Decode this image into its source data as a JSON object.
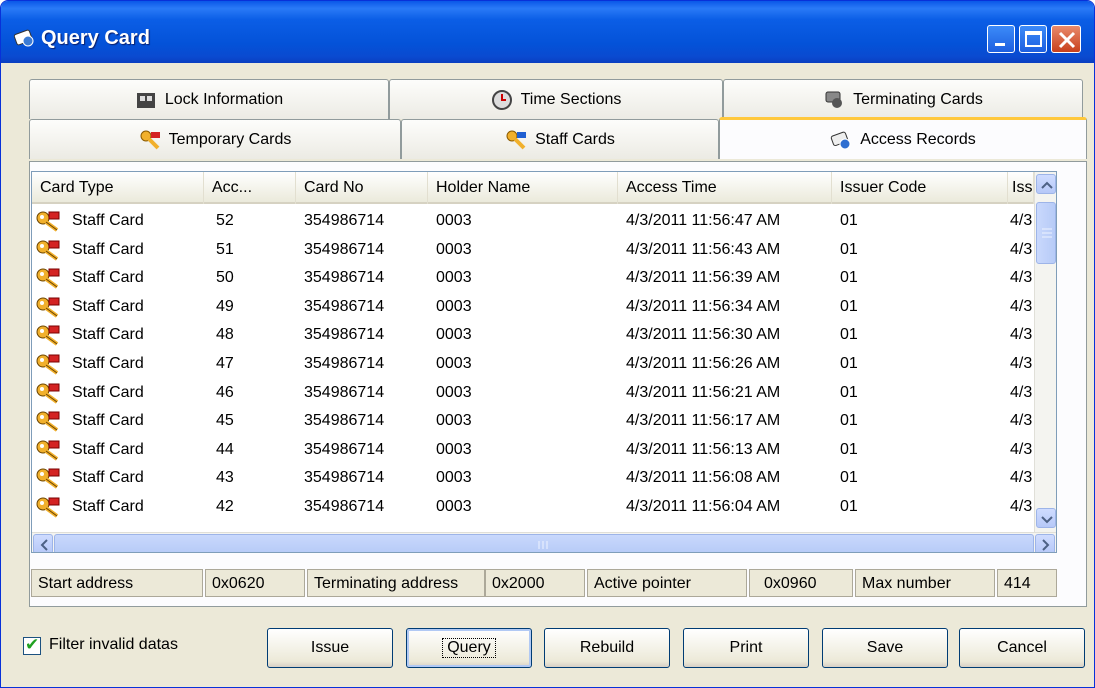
{
  "window": {
    "title": "Query Card"
  },
  "tabs_row1": [
    {
      "label": "Lock Information",
      "icon": "lock-info-icon"
    },
    {
      "label": "Time Sections",
      "icon": "time-sections-icon"
    },
    {
      "label": "Terminating Cards",
      "icon": "terminating-cards-icon"
    }
  ],
  "tabs_row2": [
    {
      "label": "Temporary Cards",
      "icon": "temporary-card-icon"
    },
    {
      "label": "Staff Cards",
      "icon": "staff-card-icon"
    },
    {
      "label": "Access Records",
      "icon": "access-records-icon",
      "active": true
    }
  ],
  "table": {
    "columns": [
      "Card Type",
      "Acc...",
      "Card No",
      "Holder Name",
      "Access Time",
      "Issuer Code",
      "Iss"
    ],
    "rows": [
      [
        "Staff Card",
        "52",
        "354986714",
        "0003",
        "4/3/2011 11:56:47 AM",
        "01",
        "4/3"
      ],
      [
        "Staff Card",
        "51",
        "354986714",
        "0003",
        "4/3/2011 11:56:43 AM",
        "01",
        "4/3"
      ],
      [
        "Staff Card",
        "50",
        "354986714",
        "0003",
        "4/3/2011 11:56:39 AM",
        "01",
        "4/3"
      ],
      [
        "Staff Card",
        "49",
        "354986714",
        "0003",
        "4/3/2011 11:56:34 AM",
        "01",
        "4/3"
      ],
      [
        "Staff Card",
        "48",
        "354986714",
        "0003",
        "4/3/2011 11:56:30 AM",
        "01",
        "4/3"
      ],
      [
        "Staff Card",
        "47",
        "354986714",
        "0003",
        "4/3/2011 11:56:26 AM",
        "01",
        "4/3"
      ],
      [
        "Staff Card",
        "46",
        "354986714",
        "0003",
        "4/3/2011 11:56:21 AM",
        "01",
        "4/3"
      ],
      [
        "Staff Card",
        "45",
        "354986714",
        "0003",
        "4/3/2011 11:56:17 AM",
        "01",
        "4/3"
      ],
      [
        "Staff Card",
        "44",
        "354986714",
        "0003",
        "4/3/2011 11:56:13 AM",
        "01",
        "4/3"
      ],
      [
        "Staff Card",
        "43",
        "354986714",
        "0003",
        "4/3/2011 11:56:08 AM",
        "01",
        "4/3"
      ],
      [
        "Staff Card",
        "42",
        "354986714",
        "0003",
        "4/3/2011 11:56:04 AM",
        "01",
        "4/3"
      ]
    ]
  },
  "status": {
    "start_label": "Start address",
    "start_value": "0x0620",
    "term_label": "Terminating address",
    "term_value": "0x2000",
    "pointer_label": "Active pointer",
    "pointer_value": "0x0960",
    "max_label": "Max number",
    "max_value": "414"
  },
  "filter": {
    "label": "Filter invalid datas",
    "checked": true
  },
  "buttons": {
    "issue": "Issue",
    "query": "Query",
    "rebuild": "Rebuild",
    "print": "Print",
    "save": "Save",
    "cancel": "Cancel"
  },
  "colors": {
    "titlebar": "#0a57e8",
    "face": "#ece9d8",
    "active_tab_accent": "#ffc83c"
  }
}
